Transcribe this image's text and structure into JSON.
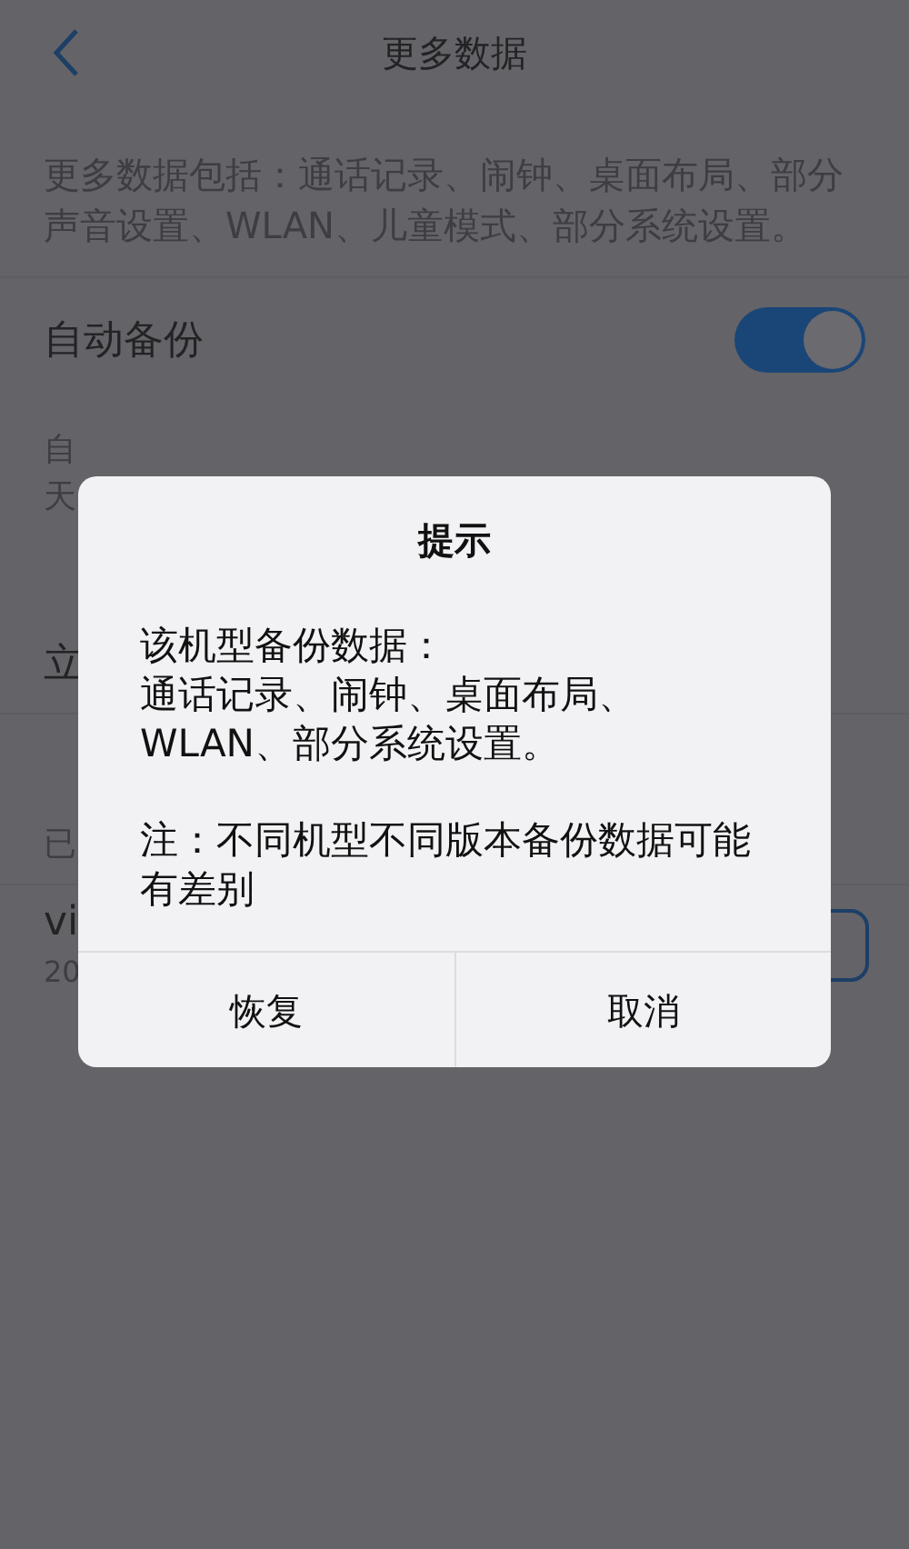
{
  "header": {
    "title": "更多数据"
  },
  "description": "更多数据包括：通话记录、闹钟、桌面布局、部分声音设置、WLAN、儿童模式、部分系统设置。",
  "auto_backup": {
    "label": "自动备份",
    "on": true,
    "note_lines": [
      "自",
      "天"
    ]
  },
  "backup_now": {
    "label": "立"
  },
  "backed_up": {
    "label": "已"
  },
  "backup_item": {
    "name": "vi",
    "date": "20"
  },
  "dialog": {
    "title": "提示",
    "body": [
      "该机型备份数据：",
      "通话记录、闹钟、桌面布局、",
      "WLAN、部分系统设置。"
    ],
    "note": "注：不同机型不同版本备份数据可能有差别",
    "buttons": [
      "恢复",
      "取消"
    ]
  }
}
